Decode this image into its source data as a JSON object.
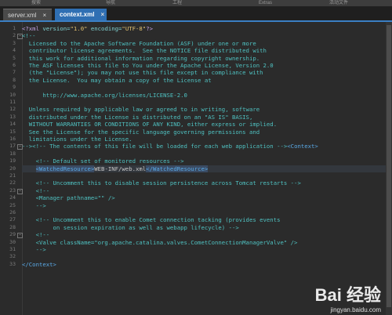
{
  "menu": [
    "搜索",
    "导航",
    "工程",
    "Extras",
    "活动文件"
  ],
  "tabs": [
    {
      "label": "server.xml",
      "active": false
    },
    {
      "label": "context.xml",
      "active": true
    }
  ],
  "colors": {
    "background": "#2b2b2b",
    "active_tab": "#2f6fb3",
    "comment": "#4fc1c1",
    "tag": "#5aa9e6",
    "string": "#e0c070",
    "selection": "#3a4b63"
  },
  "lines": [
    {
      "n": "1",
      "segs": [
        {
          "t": "<?xml ",
          "c": "t-decl"
        },
        {
          "t": "version=",
          "c": "t-attr"
        },
        {
          "t": "\"1.0\"",
          "c": "t-str"
        },
        {
          "t": " encoding=",
          "c": "t-attr"
        },
        {
          "t": "\"UTF-8\"",
          "c": "t-str"
        },
        {
          "t": "?>",
          "c": "t-decl"
        }
      ]
    },
    {
      "n": "2",
      "segs": [
        {
          "t": "<!--",
          "c": "t-comment"
        }
      ]
    },
    {
      "n": "3",
      "segs": [
        {
          "t": "  Licensed to the Apache Software Foundation (ASF) under one or more",
          "c": "t-comment"
        }
      ]
    },
    {
      "n": "4",
      "segs": [
        {
          "t": "  contributor license agreements.  See the NOTICE file distributed with",
          "c": "t-comment"
        }
      ]
    },
    {
      "n": "5",
      "segs": [
        {
          "t": "  this work for additional information regarding copyright ownership.",
          "c": "t-comment"
        }
      ]
    },
    {
      "n": "6",
      "segs": [
        {
          "t": "  The ASF licenses this file to You under the Apache License, Version 2.0",
          "c": "t-comment"
        }
      ]
    },
    {
      "n": "7",
      "segs": [
        {
          "t": "  (the \"License\"); you may not use this file except in compliance with",
          "c": "t-comment"
        }
      ]
    },
    {
      "n": "8",
      "segs": [
        {
          "t": "  the License.  You may obtain a copy of the License at",
          "c": "t-comment"
        }
      ]
    },
    {
      "n": "9",
      "segs": [
        {
          "t": "",
          "c": "t-comment"
        }
      ]
    },
    {
      "n": "10",
      "segs": [
        {
          "t": "      http://www.apache.org/licenses/LICENSE-2.0",
          "c": "t-comment"
        }
      ]
    },
    {
      "n": "11",
      "segs": [
        {
          "t": "",
          "c": "t-comment"
        }
      ]
    },
    {
      "n": "12",
      "segs": [
        {
          "t": "  Unless required by applicable law or agreed to in writing, software",
          "c": "t-comment"
        }
      ]
    },
    {
      "n": "13",
      "segs": [
        {
          "t": "  distributed under the License is distributed on an \"AS IS\" BASIS,",
          "c": "t-comment"
        }
      ]
    },
    {
      "n": "14",
      "segs": [
        {
          "t": "  WITHOUT WARRANTIES OR CONDITIONS OF ANY KIND, either express or implied.",
          "c": "t-comment"
        }
      ]
    },
    {
      "n": "15",
      "segs": [
        {
          "t": "  See the License for the specific language governing permissions and",
          "c": "t-comment"
        }
      ]
    },
    {
      "n": "16",
      "segs": [
        {
          "t": "  limitations under the License.",
          "c": "t-comment"
        }
      ]
    },
    {
      "n": "17",
      "segs": [
        {
          "t": "--><!-- The contents of this file will be loaded for each web application -->",
          "c": "t-comment"
        },
        {
          "t": "<Context>",
          "c": "t-tag"
        }
      ]
    },
    {
      "n": "18",
      "segs": [
        {
          "t": "",
          "c": "t-text"
        }
      ]
    },
    {
      "n": "19",
      "segs": [
        {
          "t": "    <!-- Default set of monitored resources -->",
          "c": "t-comment"
        }
      ]
    },
    {
      "n": "20",
      "current": true,
      "segs": [
        {
          "t": "    ",
          "c": "t-text"
        },
        {
          "t": "<WatchedResource>",
          "c": "t-tag hl"
        },
        {
          "t": "WEB-INF/web.xml",
          "c": "t-text"
        },
        {
          "t": "</WatchedResource>",
          "c": "t-tag hl"
        }
      ]
    },
    {
      "n": "21",
      "segs": [
        {
          "t": "",
          "c": "t-text"
        }
      ]
    },
    {
      "n": "22",
      "segs": [
        {
          "t": "    <!-- Uncomment this to disable session persistence across Tomcat restarts -->",
          "c": "t-comment"
        }
      ]
    },
    {
      "n": "23",
      "segs": [
        {
          "t": "    <!--",
          "c": "t-comment"
        }
      ]
    },
    {
      "n": "24",
      "segs": [
        {
          "t": "    <Manager pathname=\"\" />",
          "c": "t-comment"
        }
      ]
    },
    {
      "n": "25",
      "segs": [
        {
          "t": "    -->",
          "c": "t-comment"
        }
      ]
    },
    {
      "n": "26",
      "segs": [
        {
          "t": "",
          "c": "t-text"
        }
      ]
    },
    {
      "n": "27",
      "segs": [
        {
          "t": "    <!-- Uncomment this to enable Comet connection tacking (provides events",
          "c": "t-comment"
        }
      ]
    },
    {
      "n": "28",
      "segs": [
        {
          "t": "         on session expiration as well as webapp lifecycle) -->",
          "c": "t-comment"
        }
      ]
    },
    {
      "n": "29",
      "segs": [
        {
          "t": "    <!--",
          "c": "t-comment"
        }
      ]
    },
    {
      "n": "30",
      "segs": [
        {
          "t": "    <Valve className=\"org.apache.catalina.valves.CometConnectionManagerValve\" />",
          "c": "t-comment"
        }
      ]
    },
    {
      "n": "31",
      "segs": [
        {
          "t": "    -->",
          "c": "t-comment"
        }
      ]
    },
    {
      "n": "32",
      "segs": [
        {
          "t": "",
          "c": "t-text"
        }
      ]
    },
    {
      "n": "33",
      "segs": [
        {
          "t": "</Context>",
          "c": "t-tag"
        }
      ]
    }
  ],
  "folds": [
    "2",
    "17",
    "23",
    "29"
  ],
  "watermark": {
    "brand": "Bai 经验",
    "url": "jingyan.baidu.com"
  }
}
